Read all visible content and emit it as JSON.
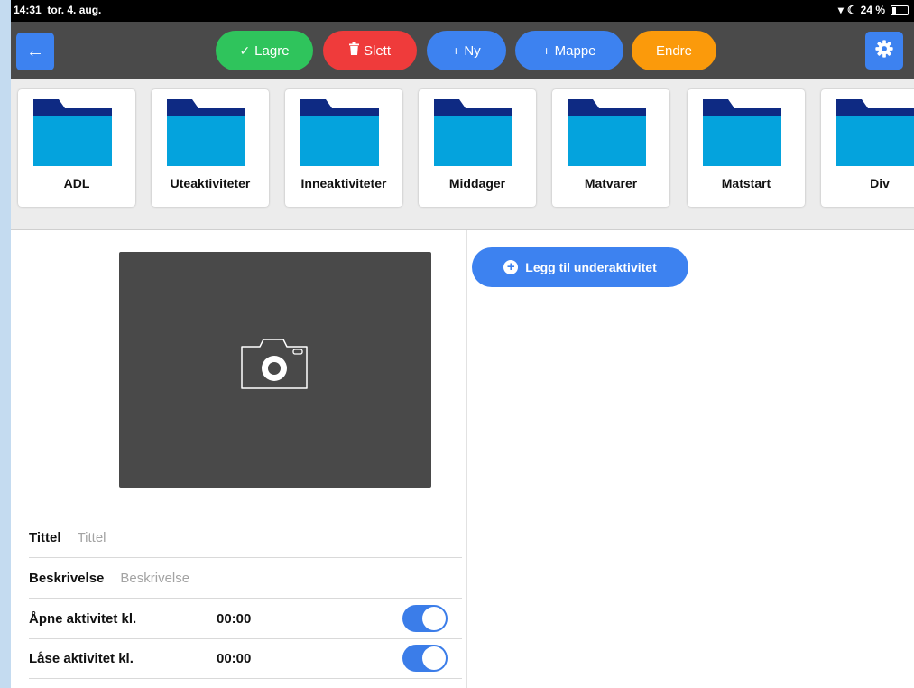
{
  "status_bar": {
    "time": "14:31",
    "date": "tor. 4. aug.",
    "battery": "24 %",
    "battery_level": 0.24
  },
  "toolbar": {
    "back_icon": "arrow-left-icon",
    "buttons": [
      {
        "label": "Lagre",
        "icon": "✓",
        "color": "#2fc45c"
      },
      {
        "label": "Slett",
        "icon": "trash",
        "color": "#ef3b3b"
      },
      {
        "label": "Ny",
        "icon": "+",
        "color": "#3d82f0"
      },
      {
        "label": "Mappe",
        "icon": "+",
        "color": "#3d82f0"
      },
      {
        "label": "Endre",
        "icon": "",
        "color": "#fb9a0b"
      }
    ],
    "settings_icon": "gear-icon"
  },
  "folders": [
    {
      "label": "ADL"
    },
    {
      "label": "Uteaktiviteter"
    },
    {
      "label": "Inneaktiviteter"
    },
    {
      "label": "Middager"
    },
    {
      "label": "Matvarer"
    },
    {
      "label": "Matstart"
    },
    {
      "label": "Div"
    }
  ],
  "folder_colors": {
    "body": "#04a3dd",
    "tab": "#0e2a83"
  },
  "form": {
    "title_label": "Tittel",
    "title_placeholder": "Tittel",
    "title_value": "",
    "description_label": "Beskrivelse",
    "description_placeholder": "Beskrivelse",
    "description_value": "",
    "open_label": "Åpne aktivitet kl.",
    "open_time": "00:00",
    "open_enabled": true,
    "lock_label": "Låse aktivitet kl.",
    "lock_time": "00:00",
    "lock_enabled": true
  },
  "add_subactivity": {
    "label": "Legg til underaktivitet"
  },
  "colors": {
    "accent_blue": "#3d82f0",
    "toolbar_bg": "#4a4a4a",
    "photo_bg": "#494949"
  }
}
